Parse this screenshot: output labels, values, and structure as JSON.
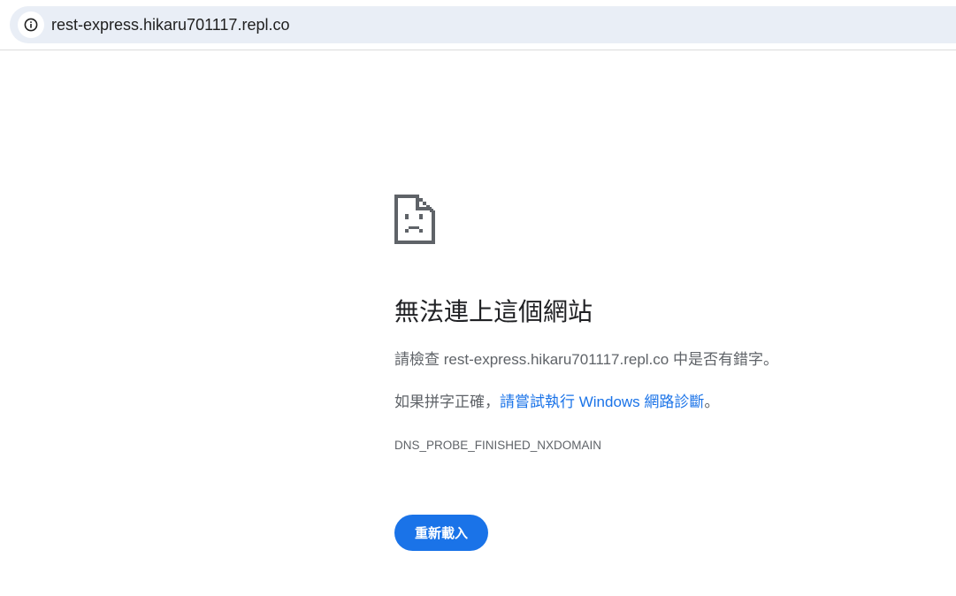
{
  "address_bar": {
    "url": "rest-express.hikaru701117.repl.co",
    "site_info_icon": "info-circle-icon"
  },
  "error_page": {
    "icon": "sad-document-icon",
    "title": "無法連上這個網站",
    "check_prefix": "請檢查 ",
    "check_host": "rest-express.hikaru701117.repl.co",
    "check_suffix": " 中是否有錯字。",
    "spelling_prefix": "如果拼字正確，",
    "diagnostics_link": "請嘗試執行 Windows 網路診斷",
    "spelling_suffix": "。",
    "error_code": "DNS_PROBE_FINISHED_NXDOMAIN",
    "reload_label": "重新載入"
  },
  "colors": {
    "accent": "#1a73e8",
    "omnibox_bg": "#e9eef6",
    "body_text": "#5f6368",
    "title_text": "#202124"
  }
}
